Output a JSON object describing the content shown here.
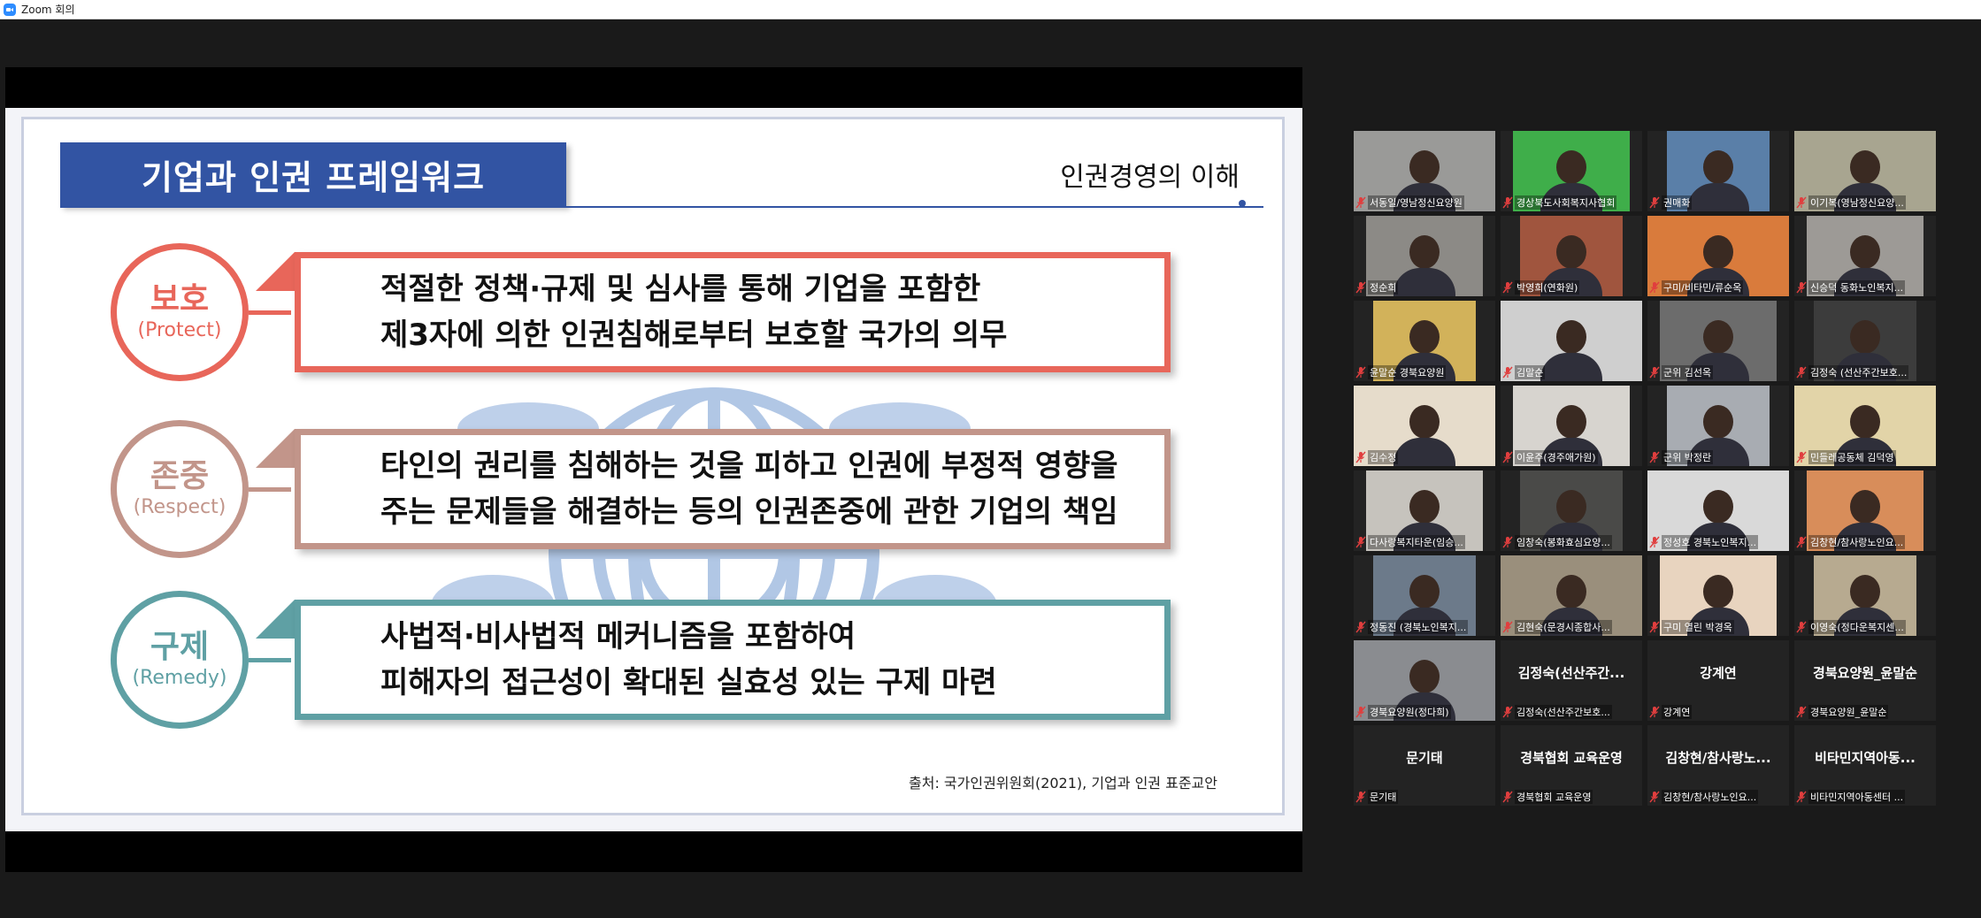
{
  "window": {
    "title": "Zoom 회의"
  },
  "slide": {
    "title": "기업과 인권 프레임워크",
    "subtitle": "인권경영의 이해",
    "rows": [
      {
        "kr": "보호",
        "en": "(Protect)",
        "color": "#e8665a",
        "box_color": "#e8665a",
        "lines": [
          "적절한 정책·규제 및 심사를 통해 기업을 포함한",
          "제3자에 의한 인권침해로부터 보호할 국가의 의무"
        ]
      },
      {
        "kr": "존중",
        "en": "(Respect)",
        "color": "#c2958a",
        "box_color": "#c2958a",
        "lines": [
          "타인의 권리를 침해하는 것을 피하고 인권에 부정적 영향을",
          "주는 문제들을 해결하는 등의 인권존중에  관한 기업의 책임"
        ]
      },
      {
        "kr": "구제",
        "en": "(Remedy)",
        "color": "#5fa0a4",
        "box_color": "#5fa0a4",
        "lines": [
          "사법적·비사법적 메커니즘을 포함하여",
          "피해자의 접근성이 확대된 실효성 있는 구제  마련"
        ]
      }
    ],
    "source": "출처: 국가인권위원회(2021), 기업과 인권 표준교안"
  },
  "gallery": {
    "participants": [
      {
        "label": "서동일/영남정신요양원",
        "video": true,
        "bg": "#9a9a98"
      },
      {
        "label": "경상북도사회복지사협회",
        "video": true,
        "bg": "#3fae4a"
      },
      {
        "label": "권매화",
        "video": true,
        "bg": "#5a7fa8"
      },
      {
        "label": "이기복(영남정신요양...",
        "video": true,
        "bg": "#a8a590"
      },
      {
        "label": "정순희",
        "video": true,
        "bg": "#8c8a86"
      },
      {
        "label": "박영희(연화원)",
        "video": true,
        "bg": "#a0553e"
      },
      {
        "label": "구미/비타민/류순옥",
        "video": true,
        "bg": "#d97b3c"
      },
      {
        "label": "신승덕 동화노인복지...",
        "video": true,
        "bg": "#9d9a96"
      },
      {
        "label": "윤말순 경북요양원",
        "video": true,
        "bg": "#d2b25a"
      },
      {
        "label": "김말순",
        "video": true,
        "bg": "#cfcfcf"
      },
      {
        "label": "군위 김선옥",
        "video": true,
        "bg": "#6c6c6c"
      },
      {
        "label": "김정숙 (선산주간보호...",
        "video": true,
        "bg": "#3c3c3c"
      },
      {
        "label": "김수정",
        "video": true,
        "bg": "#e6dccb",
        "speaking": true
      },
      {
        "label": "이윤주(경주애가원)",
        "video": true,
        "bg": "#d7d4cf"
      },
      {
        "label": "군위 박정란",
        "video": true,
        "bg": "#a8acb2"
      },
      {
        "label": "민들레공동체 김덕영",
        "video": true,
        "bg": "#e2d4a8"
      },
      {
        "label": "다사랑복지타운(임승...",
        "video": true,
        "bg": "#c6c3bd"
      },
      {
        "label": "임창숙(봉화효심요양...",
        "video": true,
        "bg": "#4a4a48"
      },
      {
        "label": "정성호 경북노인복지...",
        "video": true,
        "bg": "#d9d9d9"
      },
      {
        "label": "김창현/참사랑노인요...",
        "video": true,
        "bg": "#d88d5a"
      },
      {
        "label": "정동진 (경북노인복지...",
        "video": true,
        "bg": "#6c7a8a"
      },
      {
        "label": "김현숙(문경시종합사...",
        "video": true,
        "bg": "#9a8f7c"
      },
      {
        "label": "구미 열린 박경옥",
        "video": true,
        "bg": "#e8d4bf"
      },
      {
        "label": "이영숙(정다운복지센...",
        "video": true,
        "bg": "#b7aa90"
      },
      {
        "label": "경북요양원(정다희)",
        "video": true,
        "bg": "#8a8c90"
      },
      {
        "label": "김정숙(선산주간보호...",
        "video": false,
        "name": "김정숙(선산주간..."
      },
      {
        "label": "강계연",
        "video": false,
        "name": "강계연"
      },
      {
        "label": "경북요양원_윤말순",
        "video": false,
        "name": "경북요양원_윤말순"
      },
      {
        "label": "문기태",
        "video": false,
        "name": "문기태"
      },
      {
        "label": "경북협회 교육운영",
        "video": false,
        "name": "경북협회 교육운영"
      },
      {
        "label": "김창현/참사랑노인요...",
        "video": false,
        "name": "김창현/참사랑노..."
      },
      {
        "label": "비타민지역아동센터 ...",
        "video": false,
        "name": "비타민지역아동..."
      }
    ]
  }
}
